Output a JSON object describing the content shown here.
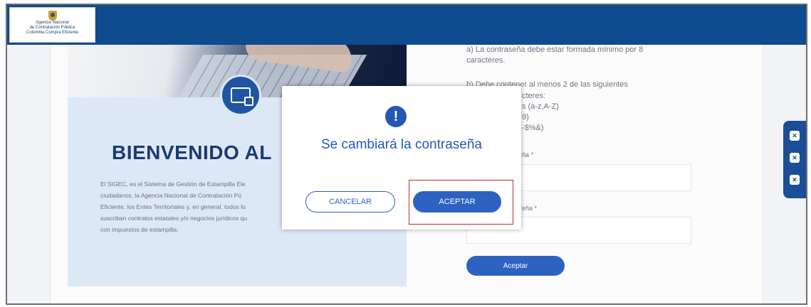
{
  "header": {
    "logo_lines": [
      "Agencia Nacional",
      "de Contratación Pública",
      "Colombia Compra Eficiente"
    ]
  },
  "welcome": {
    "title": "BIENVENIDO AL",
    "intro_lines": [
      "El SIGEC, es el Sistema de Gestión de Estampilla Ele",
      "ciudadanos, la Agencia Nacional de Contratación Pú",
      "Eficiente, los Entes Territoriales y, en general, todos lo",
      "suscriban contratos estatales y/o negocios jurídicos qu",
      "con impuestos de estampilla."
    ]
  },
  "requirements": {
    "line_a1": "a) La contraseña debe estar formada mínimo por 8",
    "line_a2": "caracteres.",
    "line_b1": "b) Debe contener al menos 2 de las siguientes",
    "line_b2": "cteres:",
    "line_b3": "s (a-z,A-Z)",
    "line_b4": "9)",
    "line_b5": "-$%&)"
  },
  "form": {
    "field1_label": "ña *",
    "field2_label": "eña *",
    "submit_label": "Aceptar"
  },
  "dialog": {
    "icon": "!",
    "title": "Se cambiará la contraseña",
    "cancel_label": "CANCELAR",
    "accept_label": "ACEPTAR"
  },
  "colors": {
    "topbar": "#0e4b8f",
    "accent": "#2457b6",
    "highlight": "#c8262b"
  }
}
